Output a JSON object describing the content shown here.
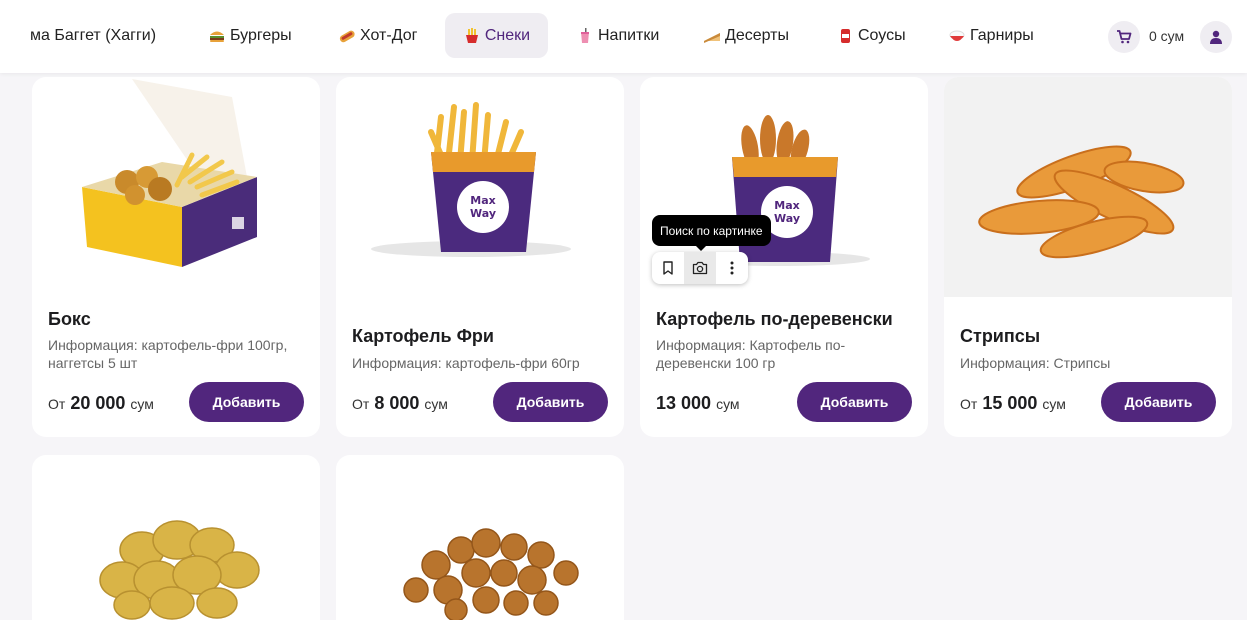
{
  "nav": {
    "items": [
      {
        "label": "ма Баггет (Хагги)",
        "icon": "",
        "active": false
      },
      {
        "label": "Бургеры",
        "icon": "burger-icon",
        "active": false
      },
      {
        "label": "Хот-Дог",
        "icon": "hotdog-icon",
        "active": false
      },
      {
        "label": "Снеки",
        "icon": "fries-icon",
        "active": true
      },
      {
        "label": "Напитки",
        "icon": "drink-icon",
        "active": false
      },
      {
        "label": "Десерты",
        "icon": "cake-icon",
        "active": false
      },
      {
        "label": "Соусы",
        "icon": "sauce-icon",
        "active": false
      },
      {
        "label": "Гарниры",
        "icon": "rice-bowl-icon",
        "active": false
      }
    ],
    "cart_total": "0 сум"
  },
  "products": [
    {
      "title": "Бокс",
      "info": "Информация: картофель-фри 100гр, наггетсы 5 шт",
      "price_prefix": "От",
      "price": "20 000",
      "currency": "сум",
      "button": "Добавить"
    },
    {
      "title": "Картофель Фри",
      "info": "Информация: картофель-фри 60гр",
      "price_prefix": "От",
      "price": "8 000",
      "currency": "сум",
      "button": "Добавить"
    },
    {
      "title": "Картофель по-деревенски",
      "info": "Информация: Картофель по-деревенски 100 гр",
      "price_prefix": "",
      "price": "13 000",
      "currency": "сум",
      "button": "Добавить"
    },
    {
      "title": "Стрипсы",
      "info": "Информация: Стрипсы",
      "price_prefix": "От",
      "price": "15 000",
      "currency": "сум",
      "button": "Добавить"
    }
  ],
  "overlay": {
    "tooltip": "Поиск по картинке"
  },
  "colors": {
    "accent": "#51267d",
    "nav_active_bg": "#efedf2",
    "page_bg": "#f6f5f8"
  }
}
